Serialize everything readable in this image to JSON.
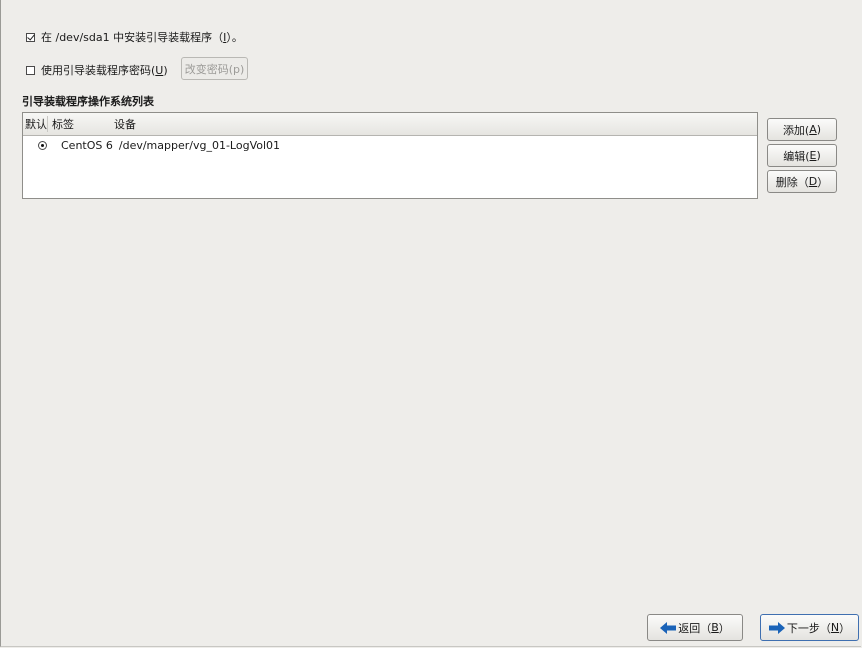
{
  "install_option": {
    "checked": true,
    "label": "在 /dev/sda1 中安装引导装载程序（",
    "mnemonic": "I",
    "suffix": "）。"
  },
  "password_option": {
    "checked": false,
    "label": "使用引导装载程序密码(",
    "mnemonic": "U",
    "suffix": ")",
    "change_button": "改变密码(p)"
  },
  "os_list": {
    "title": "引导装载程序操作系统列表",
    "columns": [
      "默认",
      "标签",
      "设备"
    ],
    "rows": [
      {
        "default": true,
        "label": "CentOS 6",
        "device": "/dev/mapper/vg_01-LogVol01"
      }
    ]
  },
  "actions": {
    "add": {
      "label": "添加(",
      "mnemonic": "A",
      "suffix": ")"
    },
    "edit": {
      "label": "编辑(",
      "mnemonic": "E",
      "suffix": ")"
    },
    "delete": {
      "label": "删除（",
      "mnemonic": "D",
      "suffix": "）"
    }
  },
  "navigation": {
    "back": {
      "label": "返回（",
      "mnemonic": "B",
      "suffix": "）",
      "icon": "arrow-left-icon"
    },
    "next": {
      "label": "下一步（",
      "mnemonic": "N",
      "suffix": "）",
      "icon": "arrow-right-icon"
    }
  },
  "colors": {
    "arrow": "#1a63b8",
    "background": "#eeedea"
  }
}
